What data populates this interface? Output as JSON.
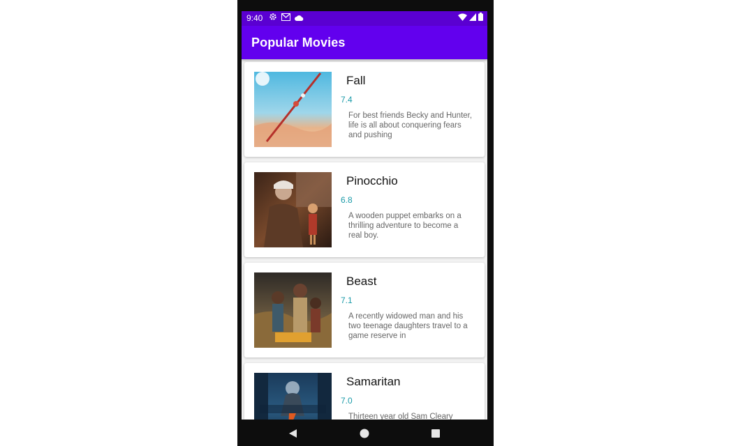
{
  "status_bar": {
    "time": "9:40",
    "left_icons": [
      "gear-icon",
      "gmail-icon",
      "cloud-icon"
    ],
    "right_icons": [
      "wifi-icon",
      "signal-icon",
      "battery-icon"
    ]
  },
  "app_bar": {
    "title": "Popular Movies"
  },
  "colors": {
    "app_bar": "#6200ee",
    "status_bar": "#5a00d1",
    "rating": "#1a9aa8"
  },
  "movies": [
    {
      "title": "Fall",
      "rating": "7.4",
      "overview": "For best friends Becky and Hunter, life is all about conquering fears and pushing"
    },
    {
      "title": "Pinocchio",
      "rating": "6.8",
      "overview": "A wooden puppet embarks on a thrilling adventure to become a real boy."
    },
    {
      "title": "Beast",
      "rating": "7.1",
      "overview": "A recently widowed man and his two teenage daughters travel to a game reserve in"
    },
    {
      "title": "Samaritan",
      "rating": "7.0",
      "overview": "Thirteen year old Sam Cleary"
    }
  ],
  "nav_bar": {
    "buttons": [
      "back-icon",
      "home-icon",
      "recents-icon"
    ]
  }
}
